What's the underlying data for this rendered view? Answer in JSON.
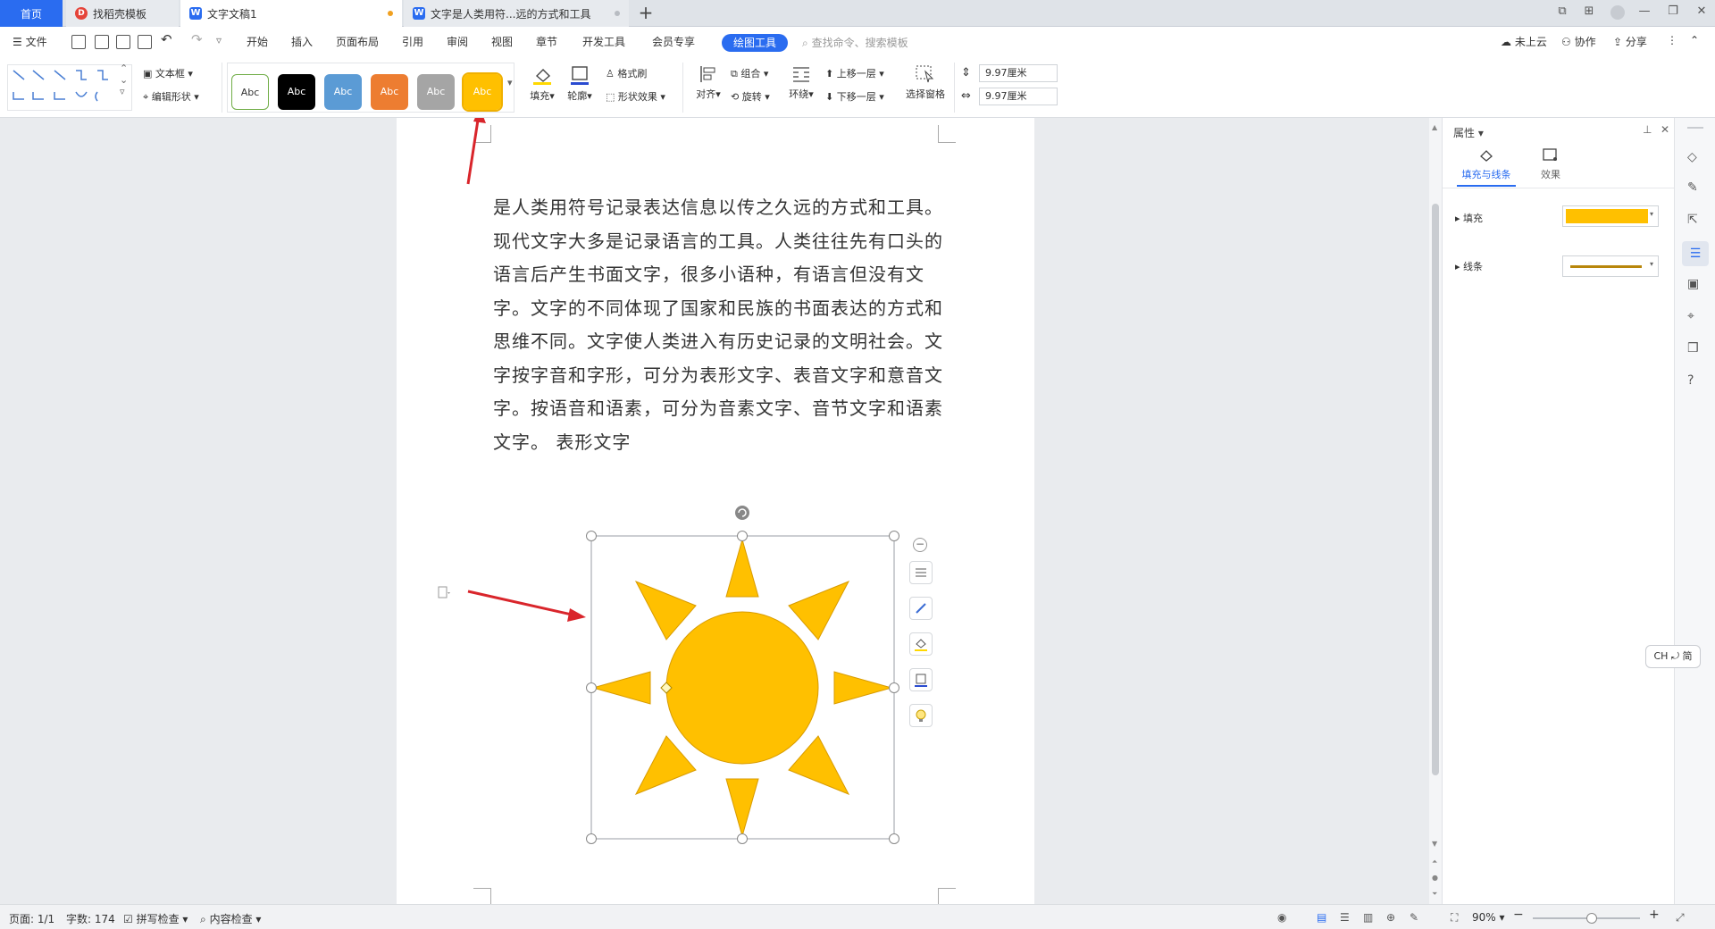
{
  "tabs": {
    "home": "首页",
    "templates": "找稻壳模板",
    "doc1": "文字文稿1",
    "doc2": "文字是人类用符...远的方式和工具",
    "add": "+"
  },
  "menu": {
    "file": "文件",
    "items": [
      "开始",
      "插入",
      "页面布局",
      "引用",
      "审阅",
      "视图",
      "章节",
      "开发工具",
      "会员专享"
    ],
    "active_tab": "绘图工具",
    "search_placeholder": "查找命令、搜索模板",
    "cloud": "未上云",
    "collab": "协作",
    "share": "分享"
  },
  "ribbon": {
    "textbox": "文本框",
    "edit_shape": "编辑形状",
    "style_sample": "Abc",
    "fill": "填充",
    "outline": "轮廓",
    "format_painter": "格式刷",
    "shape_effects": "形状效果",
    "align": "对齐",
    "group": "组合",
    "rotate": "旋转",
    "wrap": "环绕",
    "bring_forward": "上移一层",
    "send_backward": "下移一层",
    "selection_pane": "选择窗格",
    "height": "9.97厘米",
    "width": "9.97厘米"
  },
  "document": {
    "paragraph": "是人类用符号记录表达信息以传之久远的方式和工具。现代文字大多是记录语言的工具。人类往往先有口头的语言后产生书面文字，很多小语种，有语言但没有文字。文字的不同体现了国家和民族的书面表达的方式和思维不同。文字使人类进入有历史记录的文明社会。文字按字音和字形，可分为表形文字、表音文字和意音文字。按语音和语素，可分为音素文字、音节文字和语素文字。 表形文字"
  },
  "panel": {
    "title": "属性",
    "tab_fill_line": "填充与线条",
    "tab_effects": "效果",
    "fill_label": "填充",
    "line_label": "线条"
  },
  "ime": "CH ⤾ 简",
  "status": {
    "page": "页面: 1/1",
    "word_count": "字数: 174",
    "spell_check": "拼写检查",
    "content_check": "内容检查",
    "zoom": "90%"
  },
  "colors": {
    "sun": "#ffc000",
    "sun_stroke": "#d89b00",
    "accent": "#2a6cf0",
    "arrow": "#d9252b"
  }
}
